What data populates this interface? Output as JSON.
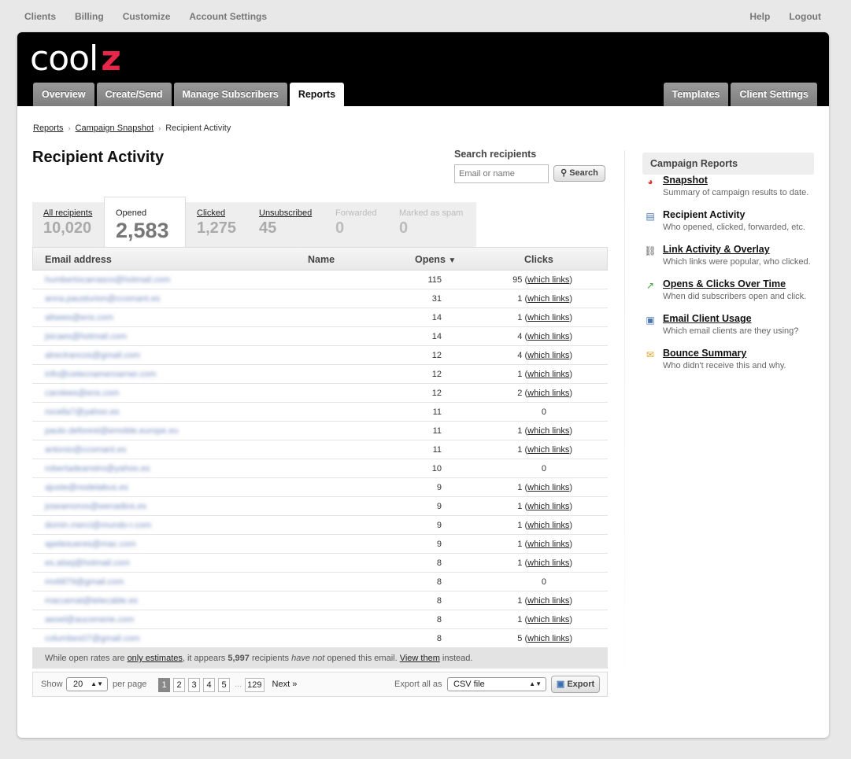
{
  "topnav": {
    "left": [
      "Clients",
      "Billing",
      "Customize",
      "Account Settings"
    ],
    "right": [
      "Help",
      "Logout"
    ]
  },
  "logo": {
    "text": "cool",
    "accent": "z"
  },
  "main_tabs": [
    "Overview",
    "Create/Send",
    "Manage Subscribers",
    "Reports"
  ],
  "right_tabs": [
    "Templates",
    "Client Settings"
  ],
  "breadcrumb": [
    "Reports",
    "Campaign Snapshot",
    "Recipient Activity"
  ],
  "page_title": "Recipient Activity",
  "search": {
    "label": "Search recipients",
    "placeholder": "Email or name",
    "button": "Search"
  },
  "stat_tabs": [
    {
      "label": "All recipients",
      "value": "10,020"
    },
    {
      "label": "Opened",
      "value": "2,583"
    },
    {
      "label": "Clicked",
      "value": "1,275"
    },
    {
      "label": "Unsubscribed",
      "value": "45"
    },
    {
      "label": "Forwarded",
      "value": "0"
    },
    {
      "label": "Marked as spam",
      "value": "0"
    }
  ],
  "table": {
    "columns": [
      "Email address",
      "Name",
      "Opens",
      "Clicks"
    ],
    "sort_indicator": "▼",
    "link_text": "which links",
    "rows": [
      {
        "email": "humbertocarrasco@hotmail.com",
        "opens": "115",
        "clicks": "95"
      },
      {
        "email": "anna.pausturion@ccomant.es",
        "opens": "31",
        "clicks": "1"
      },
      {
        "email": "alisees@ens.com",
        "opens": "14",
        "clicks": "1"
      },
      {
        "email": "jsicaes@hotmail.com",
        "opens": "14",
        "clicks": "4"
      },
      {
        "email": "alrectrancos@gmail.com",
        "opens": "12",
        "clicks": "4"
      },
      {
        "email": "info@cetecnameroarner.com",
        "opens": "12",
        "clicks": "1"
      },
      {
        "email": "carolees@ens.com",
        "opens": "12",
        "clicks": "2"
      },
      {
        "email": "rocella7@yahoo.es",
        "opens": "11",
        "clicks": "0"
      },
      {
        "email": "paulo.deforest@emoble.europe.eu",
        "opens": "11",
        "clicks": "1"
      },
      {
        "email": "antonio@ccomant.es",
        "opens": "11",
        "clicks": "1"
      },
      {
        "email": "robertadeanstro@yahoo.es",
        "opens": "10",
        "clicks": "0"
      },
      {
        "email": "ajuste@nodelabus.es",
        "opens": "9",
        "clicks": "1"
      },
      {
        "email": "joseamoros@wenadios.es",
        "opens": "9",
        "clicks": "1"
      },
      {
        "email": "domin.merci@mundo-r.com",
        "opens": "9",
        "clicks": "1"
      },
      {
        "email": "apelesueres@mac.com",
        "opens": "9",
        "clicks": "1"
      },
      {
        "email": "es.alsej@hotmail.com",
        "opens": "8",
        "clicks": "1"
      },
      {
        "email": "mv6879@gmail.com",
        "opens": "8",
        "clicks": "0"
      },
      {
        "email": "macuenat@telecable.es",
        "opens": "8",
        "clicks": "1"
      },
      {
        "email": "aeoel@aucomerie.com",
        "opens": "8",
        "clicks": "1"
      },
      {
        "email": "columbes07@gmail.com",
        "opens": "8",
        "clicks": "5"
      }
    ]
  },
  "footer_note": {
    "prefix": "While open rates are",
    "link1": "only estimates",
    "mid1": ", it appears",
    "count": "5,997",
    "mid2": "recipients",
    "em": "have not",
    "mid3": "opened this email.",
    "link2": "View them",
    "suffix": "instead."
  },
  "pager": {
    "show_label": "Show",
    "per_page": "20",
    "per_page_label": "per page",
    "pages": [
      "1",
      "2",
      "3",
      "4",
      "5"
    ],
    "ellipsis": "...",
    "last_page": "129",
    "next": "Next »",
    "export_label": "Export all as",
    "export_format": "CSV file",
    "export_button": "Export"
  },
  "sidebar": {
    "title": "Campaign Reports",
    "items": [
      {
        "title": "Snapshot",
        "desc": "Summary of campaign results to date."
      },
      {
        "title": "Recipient Activity",
        "desc": "Who opened, clicked, forwarded, etc."
      },
      {
        "title": "Link Activity & Overlay",
        "desc": "Which links were popular, who clicked."
      },
      {
        "title": "Opens & Clicks Over Time",
        "desc": "When did subscribers open and click."
      },
      {
        "title": "Email Client Usage",
        "desc": "Which email clients are they using?"
      },
      {
        "title": "Bounce Summary",
        "desc": "Who didn't receive this and why."
      }
    ]
  },
  "colors": {
    "brand_accent": "#e8264a",
    "header_bg": "#000000",
    "tab_bg": "#8c8c8c"
  }
}
